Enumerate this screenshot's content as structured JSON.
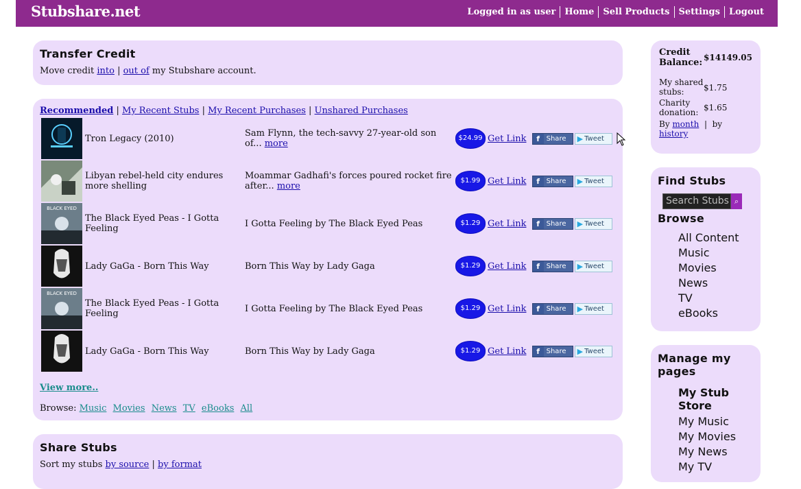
{
  "header": {
    "logo": "Stubshare.net",
    "nav": [
      "Logged in as user",
      "Home",
      "Sell Products",
      "Settings",
      "Logout"
    ]
  },
  "transfer": {
    "title": "Transfer Credit",
    "prefix": "Move credit ",
    "into": "into",
    "sep": " | ",
    "out_of": "out of",
    "suffix": " my Stubshare account."
  },
  "tabs": {
    "recommended": "Recommended",
    "recent_stubs": "My Recent Stubs",
    "recent_purchases": "My Recent Purchases",
    "unshared": "Unshared Purchases"
  },
  "items": [
    {
      "title": "Tron Legacy (2010)",
      "desc": "Sam Flynn, the tech-savvy 27-year-old son of...",
      "more": "more",
      "price": "$24.99",
      "get_link": "Get Link",
      "share": "Share",
      "tweet": "Tweet"
    },
    {
      "title": "Libyan rebel-held city endures more shelling",
      "desc": "Moammar Gadhafi's forces poured rocket fire after...",
      "more": "more",
      "price": "$1.99",
      "get_link": "Get Link",
      "share": "Share",
      "tweet": "Tweet"
    },
    {
      "title": "The Black Eyed Peas - I Gotta Feeling",
      "desc": "I Gotta Feeling by The Black Eyed Peas",
      "more": "",
      "price": "$1.29",
      "get_link": "Get Link",
      "share": "Share",
      "tweet": "Tweet"
    },
    {
      "title": "Lady GaGa - Born This Way",
      "desc": "Born This Way by Lady Gaga",
      "more": "",
      "price": "$1.29",
      "get_link": "Get Link",
      "share": "Share",
      "tweet": "Tweet"
    },
    {
      "title": "The Black Eyed Peas - I Gotta Feeling",
      "desc": "I Gotta Feeling by The Black Eyed Peas",
      "more": "",
      "price": "$1.29",
      "get_link": "Get Link",
      "share": "Share",
      "tweet": "Tweet"
    },
    {
      "title": "Lady GaGa - Born This Way",
      "desc": "Born This Way by Lady Gaga",
      "more": "",
      "price": "$1.29",
      "get_link": "Get Link",
      "share": "Share",
      "tweet": "Tweet"
    }
  ],
  "view_more": "View more..",
  "browse": {
    "label": "Browse:",
    "links": [
      "Music",
      "Movies",
      "News",
      "TV",
      "eBooks",
      "All"
    ]
  },
  "share_stubs": {
    "title": "Share Stubs",
    "prefix": "Sort my stubs ",
    "by_source": "by source",
    "sep": " | ",
    "by_format": "by format"
  },
  "credit": {
    "balance_label": "Credit Balance:",
    "balance_value": "$14149.05",
    "shared_label": "My shared stubs:",
    "shared_value": "$1.75",
    "charity_label": "Charity donation:",
    "charity_value": "$1.65",
    "by": "By ",
    "month": "month",
    "sep": "  |  by",
    "history": "history"
  },
  "find": {
    "title": "Find Stubs",
    "search_placeholder": "Search Stubs",
    "browse_title": "Browse",
    "browse_items": [
      "All Content",
      "Music",
      "Movies",
      "News",
      "TV",
      "eBooks"
    ]
  },
  "manage": {
    "title": "Manage my pages",
    "items": [
      "My Stub Store",
      "My Music",
      "My Movies",
      "My News",
      "My TV"
    ]
  },
  "colors": {
    "header": "#8e2a8e",
    "panel": "#ecdcfb",
    "price": "#1818e6",
    "link": "#1a0dab"
  }
}
